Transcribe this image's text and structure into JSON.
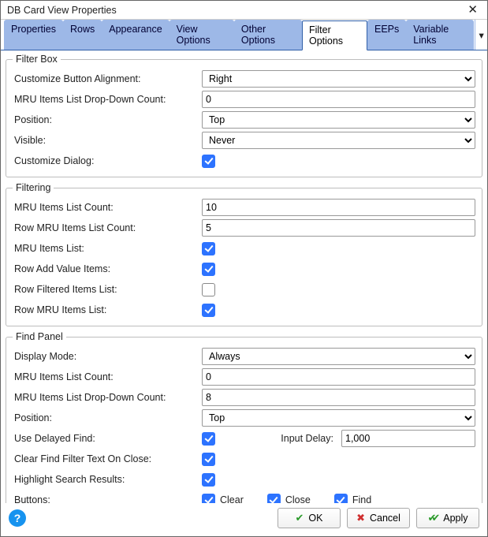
{
  "window": {
    "title": "DB Card View Properties"
  },
  "tabs": {
    "items": [
      {
        "label": "Properties"
      },
      {
        "label": "Rows"
      },
      {
        "label": "Appearance"
      },
      {
        "label": "View Options"
      },
      {
        "label": "Other Options"
      },
      {
        "label": "Filter Options",
        "active": true
      },
      {
        "label": "EEPs"
      },
      {
        "label": "Variable Links"
      }
    ]
  },
  "filter_box": {
    "legend": "Filter Box",
    "customize_button_alignment": {
      "label": "Customize Button Alignment:",
      "value": "Right"
    },
    "mru_dropdown_count": {
      "label": "MRU Items List Drop-Down Count:",
      "value": "0"
    },
    "position": {
      "label": "Position:",
      "value": "Top"
    },
    "visible": {
      "label": "Visible:",
      "value": "Never"
    },
    "customize_dialog": {
      "label": "Customize Dialog:",
      "checked": true
    }
  },
  "filtering": {
    "legend": "Filtering",
    "mru_count": {
      "label": "MRU Items List Count:",
      "value": "10"
    },
    "row_mru_count": {
      "label": "Row MRU Items List Count:",
      "value": "5"
    },
    "mru_list": {
      "label": "MRU Items List:",
      "checked": true
    },
    "row_add_value": {
      "label": "Row Add Value Items:",
      "checked": true
    },
    "row_filtered": {
      "label": "Row Filtered Items List:",
      "checked": false
    },
    "row_mru_list": {
      "label": "Row MRU Items List:",
      "checked": true
    }
  },
  "find_panel": {
    "legend": "Find Panel",
    "display_mode": {
      "label": "Display Mode:",
      "value": "Always"
    },
    "mru_count": {
      "label": "MRU Items List Count:",
      "value": "0"
    },
    "mru_dropdown_count": {
      "label": "MRU Items List Drop-Down Count:",
      "value": "8"
    },
    "position": {
      "label": "Position:",
      "value": "Top"
    },
    "use_delayed": {
      "label": "Use Delayed Find:",
      "checked": true
    },
    "input_delay": {
      "label": "Input Delay:",
      "value": "1,000"
    },
    "clear_on_close": {
      "label": "Clear Find Filter Text On Close:",
      "checked": true
    },
    "highlight": {
      "label": "Highlight Search Results:",
      "checked": true
    },
    "buttons": {
      "label": "Buttons:",
      "clear": {
        "label": "Clear",
        "checked": true
      },
      "close": {
        "label": "Close",
        "checked": true
      },
      "find": {
        "label": "Find",
        "checked": true
      }
    }
  },
  "footer": {
    "ok": "OK",
    "cancel": "Cancel",
    "apply": "Apply"
  }
}
